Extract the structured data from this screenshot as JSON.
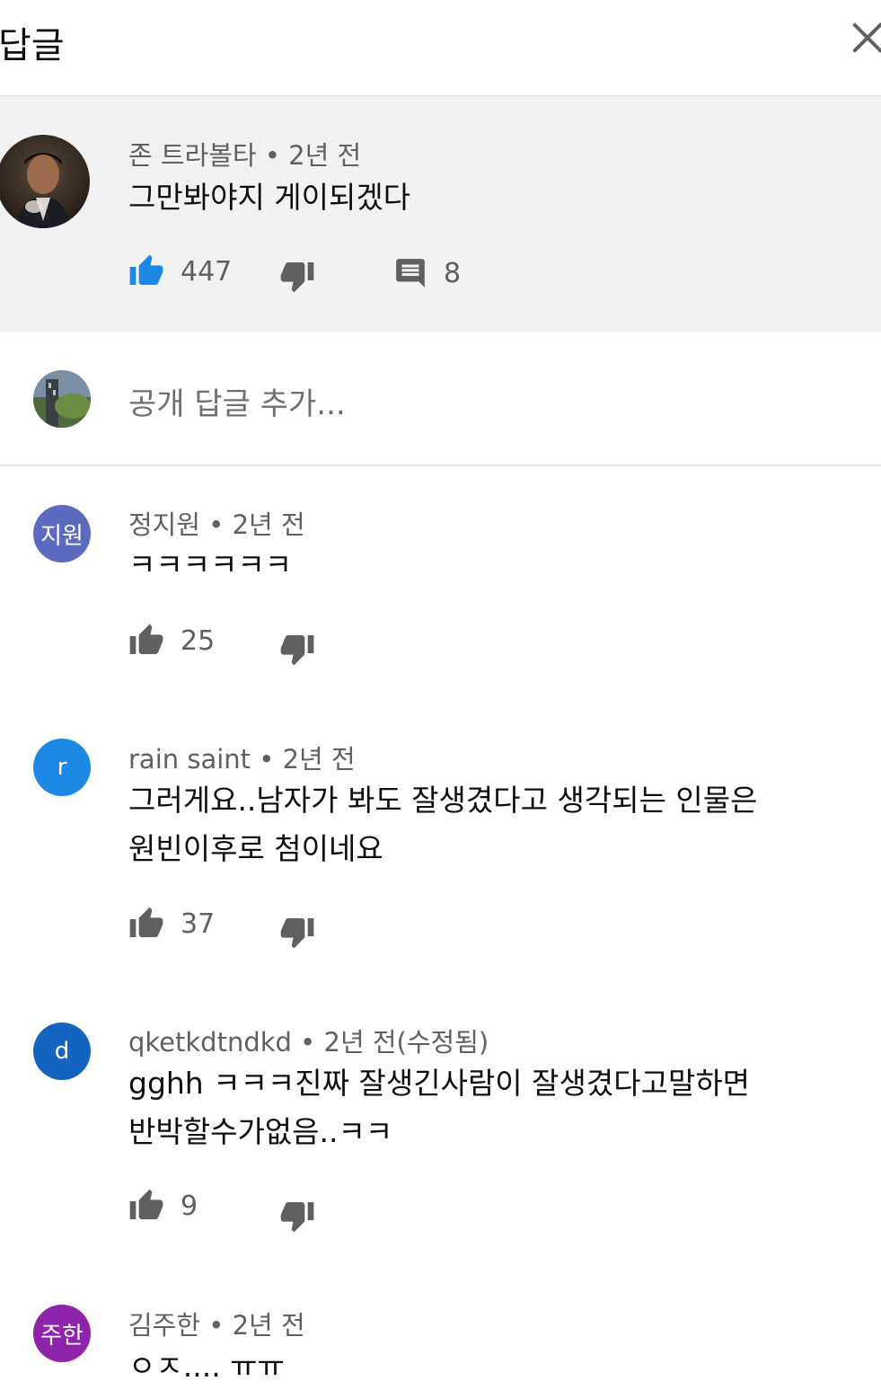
{
  "header": {
    "title": "답글"
  },
  "parent_comment": {
    "author": "존 트라볼타",
    "time": "2년 전",
    "text": "그만봐야지 게이되겠다",
    "likes": "447",
    "replies": "8"
  },
  "add_reply": {
    "placeholder": "공개 답글 추가..."
  },
  "replies": [
    {
      "author": "정지원",
      "time": "2년 전",
      "avatar_text": "지원",
      "avatar_color": "#5c6bc0",
      "lines": [
        "ㅋㅋㅋㅋㅋㅋ"
      ],
      "likes": "25"
    },
    {
      "author": "rain saint",
      "time": "2년 전",
      "avatar_text": "r",
      "avatar_color": "#1e88e5",
      "lines": [
        "그러게요..남자가 봐도 잘생겼다고 생각되는 인물은",
        "원빈이후로 첨이네요"
      ],
      "likes": "37"
    },
    {
      "author": "qketkdtndkd",
      "time": "2년 전(수정됨)",
      "avatar_text": "d",
      "avatar_color": "#1565c0",
      "lines": [
        "gghh ㅋㅋㅋ진짜 잘생긴사람이 잘생겼다고말하면",
        "반박할수가없음..ㅋㅋ"
      ],
      "likes": "9"
    },
    {
      "author": "김주한",
      "time": "2년 전",
      "avatar_text": "주한",
      "avatar_color": "#8e24aa",
      "lines": [
        "ㅇㅈ.... ㅠㅠ"
      ]
    }
  ],
  "separator": "•",
  "colors": {
    "like_active": "#1e88e5",
    "icon_gray": "#606060",
    "parent_bg": "#f2f2f2"
  }
}
